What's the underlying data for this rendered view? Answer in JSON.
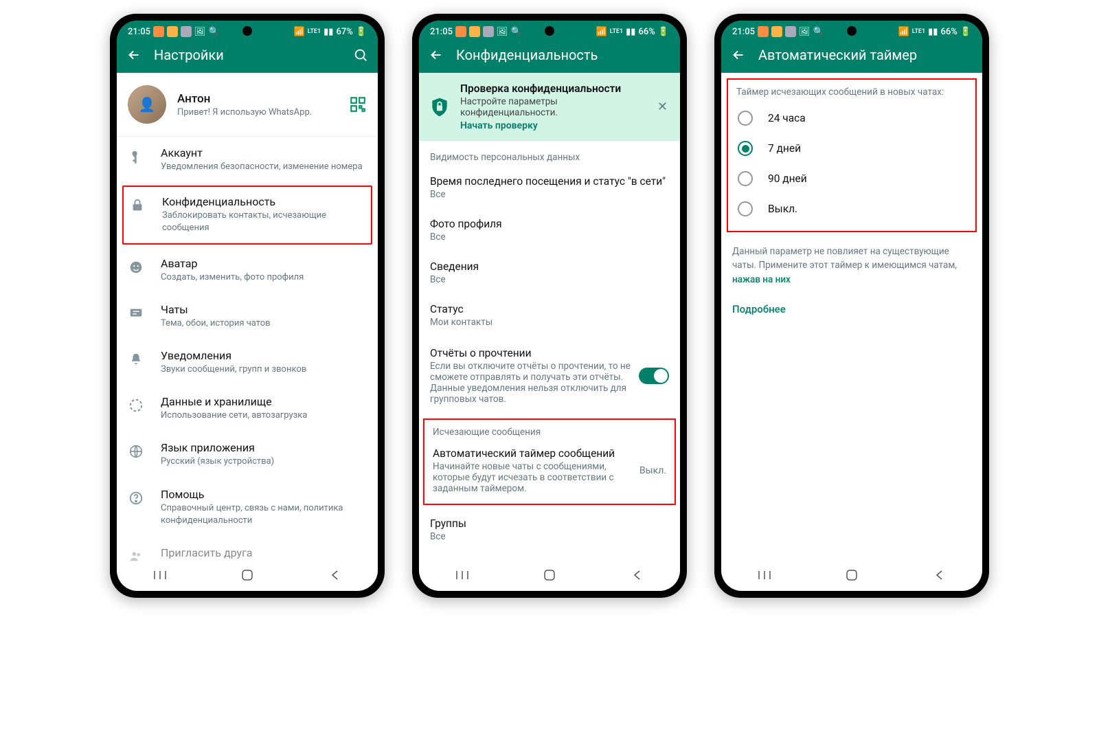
{
  "statusbar": {
    "time": "21:05",
    "batt1": "67%",
    "batt2": "66%",
    "batt3": "66%",
    "net": "LTE1"
  },
  "screen1": {
    "title": "Настройки",
    "profile": {
      "name": "Антон",
      "status": "Привет! Я использую WhatsApp."
    },
    "items": [
      {
        "title": "Аккаунт",
        "sub": "Уведомления безопасности, изменение номера"
      },
      {
        "title": "Конфиденциальность",
        "sub": "Заблокировать контакты, исчезающие сообщения"
      },
      {
        "title": "Аватар",
        "sub": "Создать, изменить, фото профиля"
      },
      {
        "title": "Чаты",
        "sub": "Тема, обои, история чатов"
      },
      {
        "title": "Уведомления",
        "sub": "Звуки сообщений, групп и звонков"
      },
      {
        "title": "Данные и хранилище",
        "sub": "Использование сети, автозагрузка"
      },
      {
        "title": "Язык приложения",
        "sub": "Русский (язык устройства)"
      },
      {
        "title": "Помощь",
        "sub": "Справочный центр, связь с нами, политика конфиденциальности"
      },
      {
        "title": "Пригласить друга",
        "sub": ""
      }
    ]
  },
  "screen2": {
    "title": "Конфиденциальность",
    "banner": {
      "title": "Проверка конфиденциальности",
      "sub": "Настройте параметры конфиденциальности.",
      "action": "Начать проверку"
    },
    "section_visibility": "Видимость персональных данных",
    "lastseen": {
      "title": "Время последнего посещения и статус \"в сети\"",
      "value": "Все"
    },
    "photo": {
      "title": "Фото профиля",
      "value": "Все"
    },
    "about": {
      "title": "Сведения",
      "value": "Все"
    },
    "status": {
      "title": "Статус",
      "value": "Мои контакты"
    },
    "readreceipts": {
      "title": "Отчёты о прочтении",
      "sub": "Если вы отключите отчёты о прочтении, то не сможете отправлять и получать эти отчёты. Данные уведомления нельзя отключить для групповых чатов."
    },
    "section_disappearing": "Исчезающие сообщения",
    "autotimer": {
      "title": "Автоматический таймер сообщений",
      "sub": "Начинайте новые чаты с сообщениями, которые будут исчезать в соответствии с заданным таймером.",
      "value": "Выкл."
    },
    "groups": {
      "title": "Группы",
      "value": "Все"
    }
  },
  "screen3": {
    "title": "Автоматический таймер",
    "header": "Таймер исчезающих сообщений в новых чатах:",
    "options": [
      {
        "label": "24 часа",
        "checked": false
      },
      {
        "label": "7 дней",
        "checked": true
      },
      {
        "label": "90 дней",
        "checked": false
      },
      {
        "label": "Выкл.",
        "checked": false
      }
    ],
    "note_a": "Данный параметр не повлияет на существующие чаты. Примените этот таймер к имеющимся чатам, ",
    "note_b": "нажав на них",
    "learn_more": "Подробнее"
  }
}
